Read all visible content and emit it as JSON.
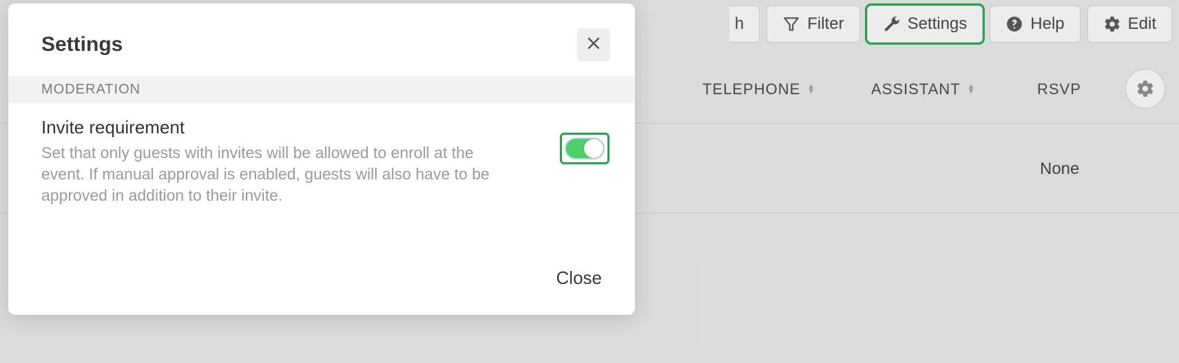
{
  "toolbar": {
    "partial_label": "h",
    "filter": "Filter",
    "settings": "Settings",
    "help": "Help",
    "edit": "Edit"
  },
  "columns": {
    "telephone": "TELEPHONE",
    "assistant": "ASSISTANT",
    "rsvp": "RSVP"
  },
  "row": {
    "rsvp_value": "None"
  },
  "modal": {
    "title": "Settings",
    "section": "MODERATION",
    "setting_title": "Invite requirement",
    "setting_desc": "Set that only guests with invites will be allowed to enroll at the event. If manual approval is enabled, guests will also have to be approved in addition to their invite.",
    "toggle_on": true,
    "close": "Close"
  },
  "colors": {
    "highlight": "#1fa748",
    "toggle_on": "#4bd06a"
  }
}
